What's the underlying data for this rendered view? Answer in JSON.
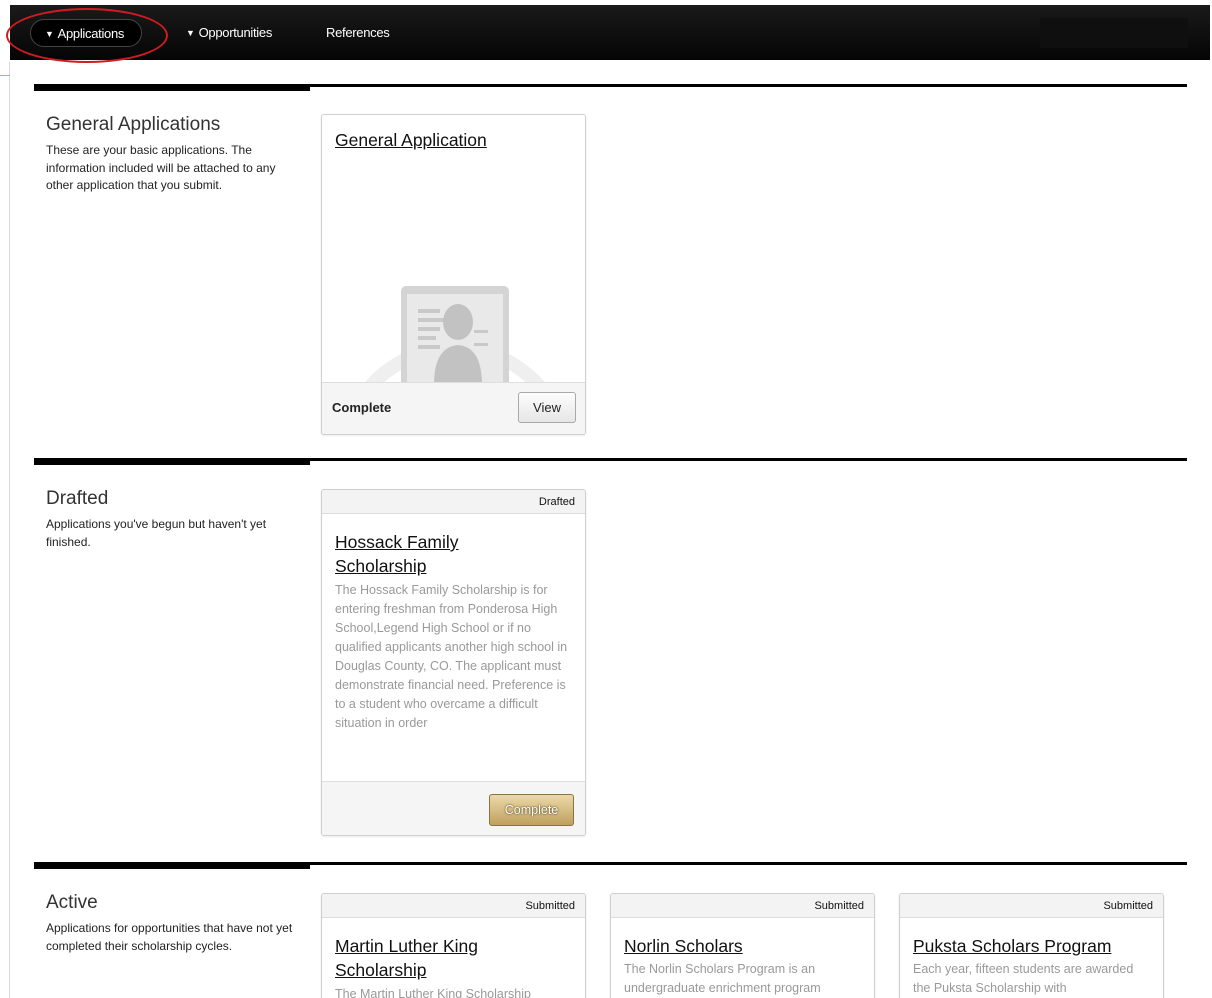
{
  "nav": {
    "applications": "Applications",
    "opportunities": "Opportunities",
    "references": "References"
  },
  "sections": {
    "general": {
      "title": "General Applications",
      "description": "These are your basic applications. The information included will be attached to any other application that you submit.",
      "card": {
        "title": "General Application",
        "status": "Complete",
        "button": "View",
        "icon": "document-profile-icon"
      }
    },
    "drafted": {
      "title": "Drafted",
      "description": "Applications you've begun but haven't yet finished.",
      "card": {
        "badge": "Drafted",
        "title": "Hossack Family Scholarship",
        "description": "The Hossack Family Scholarship is for entering freshman from Ponderosa High School,Legend High School or if no qualified applicants another high school in Douglas County, CO. The applicant must demonstrate financial need. Preference is to a student who overcame a difficult situation in order",
        "button": "Complete"
      }
    },
    "active": {
      "title": "Active",
      "description": "Applications for opportunities that have not yet completed their scholarship cycles.",
      "cards": [
        {
          "badge": "Submitted",
          "title": "Martin Luther King Scholarship",
          "description": "The Martin Luther King Scholarship"
        },
        {
          "badge": "Submitted",
          "title": "Norlin Scholars",
          "description": "The Norlin Scholars Program is an undergraduate enrichment program"
        },
        {
          "badge": "Submitted",
          "title": "Puksta Scholars Program",
          "description": "Each year, fifteen students are awarded the Puksta Scholarship with"
        }
      ]
    }
  },
  "colors": {
    "highlight_ring": "#d01c20",
    "complete_button": "#c9ad6b",
    "nav_background": "#0a0a0a"
  }
}
